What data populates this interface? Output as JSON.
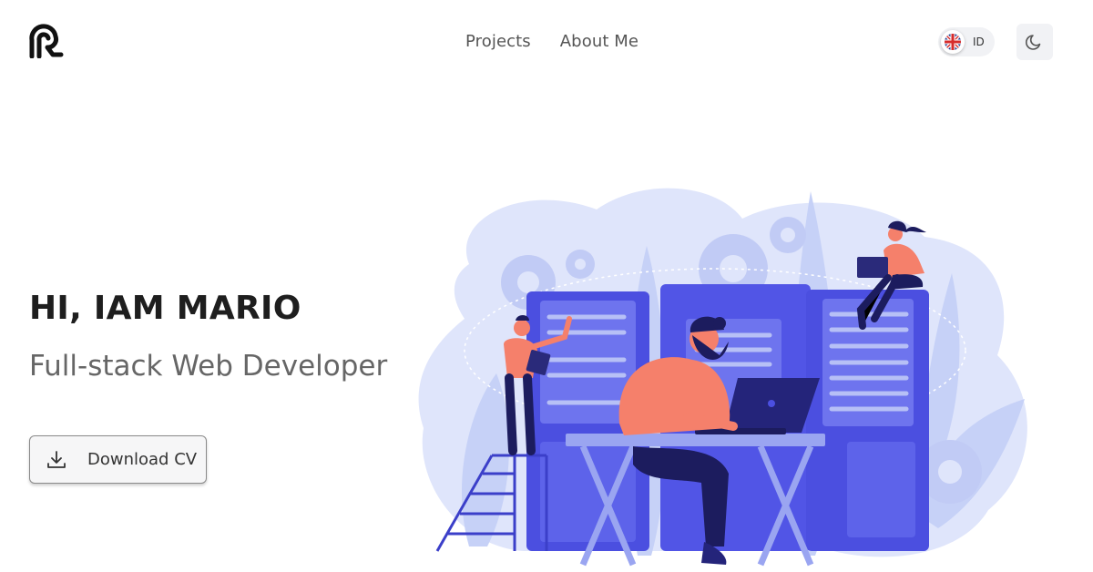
{
  "header": {
    "logo_icon": "re-logo-icon",
    "nav": [
      {
        "label": "Projects"
      },
      {
        "label": "About Me"
      }
    ],
    "language_toggle": {
      "flag_icon": "uk-flag-icon",
      "label": "ID"
    },
    "theme_toggle_icon": "moon-icon"
  },
  "hero": {
    "title": "HI, IAM MARIO",
    "subtitle": "Full-stack Web Developer",
    "download_button": {
      "label": "Download CV",
      "icon": "download-icon"
    }
  },
  "illustration": {
    "icon": "developer-server-room-illustration"
  },
  "colors": {
    "accent_blue": "#5155e6",
    "light_blue": "#dfe5fb",
    "coral": "#f5806b",
    "navy": "#2a2a7a",
    "text_dark": "#1e1e1e",
    "text_muted": "#666666"
  }
}
